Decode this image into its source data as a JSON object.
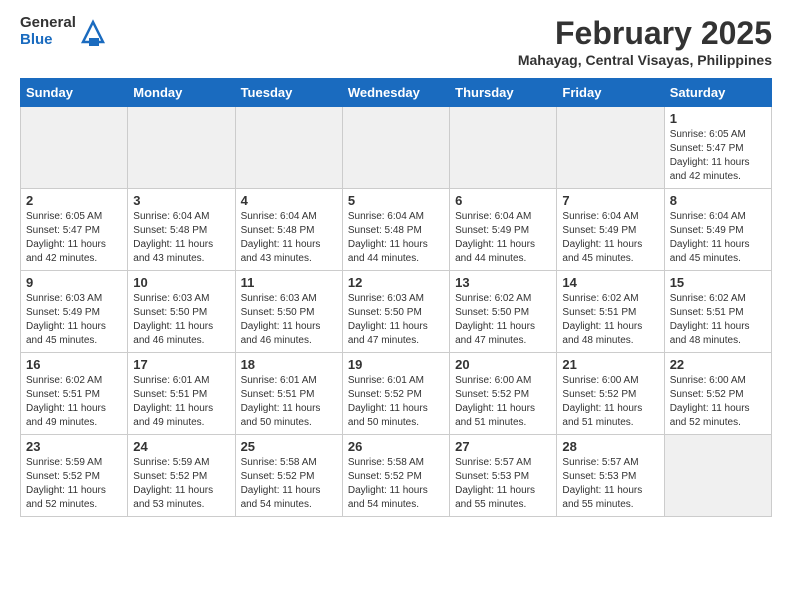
{
  "header": {
    "logo_general": "General",
    "logo_blue": "Blue",
    "month_title": "February 2025",
    "location": "Mahayag, Central Visayas, Philippines"
  },
  "days_of_week": [
    "Sunday",
    "Monday",
    "Tuesday",
    "Wednesday",
    "Thursday",
    "Friday",
    "Saturday"
  ],
  "weeks": [
    [
      {
        "num": "",
        "info": "",
        "empty": true
      },
      {
        "num": "",
        "info": "",
        "empty": true
      },
      {
        "num": "",
        "info": "",
        "empty": true
      },
      {
        "num": "",
        "info": "",
        "empty": true
      },
      {
        "num": "",
        "info": "",
        "empty": true
      },
      {
        "num": "",
        "info": "",
        "empty": true
      },
      {
        "num": "1",
        "info": "Sunrise: 6:05 AM\nSunset: 5:47 PM\nDaylight: 11 hours\nand 42 minutes."
      }
    ],
    [
      {
        "num": "2",
        "info": "Sunrise: 6:05 AM\nSunset: 5:47 PM\nDaylight: 11 hours\nand 42 minutes."
      },
      {
        "num": "3",
        "info": "Sunrise: 6:04 AM\nSunset: 5:48 PM\nDaylight: 11 hours\nand 43 minutes."
      },
      {
        "num": "4",
        "info": "Sunrise: 6:04 AM\nSunset: 5:48 PM\nDaylight: 11 hours\nand 43 minutes."
      },
      {
        "num": "5",
        "info": "Sunrise: 6:04 AM\nSunset: 5:48 PM\nDaylight: 11 hours\nand 44 minutes."
      },
      {
        "num": "6",
        "info": "Sunrise: 6:04 AM\nSunset: 5:49 PM\nDaylight: 11 hours\nand 44 minutes."
      },
      {
        "num": "7",
        "info": "Sunrise: 6:04 AM\nSunset: 5:49 PM\nDaylight: 11 hours\nand 45 minutes."
      },
      {
        "num": "8",
        "info": "Sunrise: 6:04 AM\nSunset: 5:49 PM\nDaylight: 11 hours\nand 45 minutes."
      }
    ],
    [
      {
        "num": "9",
        "info": "Sunrise: 6:03 AM\nSunset: 5:49 PM\nDaylight: 11 hours\nand 45 minutes."
      },
      {
        "num": "10",
        "info": "Sunrise: 6:03 AM\nSunset: 5:50 PM\nDaylight: 11 hours\nand 46 minutes."
      },
      {
        "num": "11",
        "info": "Sunrise: 6:03 AM\nSunset: 5:50 PM\nDaylight: 11 hours\nand 46 minutes."
      },
      {
        "num": "12",
        "info": "Sunrise: 6:03 AM\nSunset: 5:50 PM\nDaylight: 11 hours\nand 47 minutes."
      },
      {
        "num": "13",
        "info": "Sunrise: 6:02 AM\nSunset: 5:50 PM\nDaylight: 11 hours\nand 47 minutes."
      },
      {
        "num": "14",
        "info": "Sunrise: 6:02 AM\nSunset: 5:51 PM\nDaylight: 11 hours\nand 48 minutes."
      },
      {
        "num": "15",
        "info": "Sunrise: 6:02 AM\nSunset: 5:51 PM\nDaylight: 11 hours\nand 48 minutes."
      }
    ],
    [
      {
        "num": "16",
        "info": "Sunrise: 6:02 AM\nSunset: 5:51 PM\nDaylight: 11 hours\nand 49 minutes."
      },
      {
        "num": "17",
        "info": "Sunrise: 6:01 AM\nSunset: 5:51 PM\nDaylight: 11 hours\nand 49 minutes."
      },
      {
        "num": "18",
        "info": "Sunrise: 6:01 AM\nSunset: 5:51 PM\nDaylight: 11 hours\nand 50 minutes."
      },
      {
        "num": "19",
        "info": "Sunrise: 6:01 AM\nSunset: 5:52 PM\nDaylight: 11 hours\nand 50 minutes."
      },
      {
        "num": "20",
        "info": "Sunrise: 6:00 AM\nSunset: 5:52 PM\nDaylight: 11 hours\nand 51 minutes."
      },
      {
        "num": "21",
        "info": "Sunrise: 6:00 AM\nSunset: 5:52 PM\nDaylight: 11 hours\nand 51 minutes."
      },
      {
        "num": "22",
        "info": "Sunrise: 6:00 AM\nSunset: 5:52 PM\nDaylight: 11 hours\nand 52 minutes."
      }
    ],
    [
      {
        "num": "23",
        "info": "Sunrise: 5:59 AM\nSunset: 5:52 PM\nDaylight: 11 hours\nand 52 minutes."
      },
      {
        "num": "24",
        "info": "Sunrise: 5:59 AM\nSunset: 5:52 PM\nDaylight: 11 hours\nand 53 minutes."
      },
      {
        "num": "25",
        "info": "Sunrise: 5:58 AM\nSunset: 5:52 PM\nDaylight: 11 hours\nand 54 minutes."
      },
      {
        "num": "26",
        "info": "Sunrise: 5:58 AM\nSunset: 5:52 PM\nDaylight: 11 hours\nand 54 minutes."
      },
      {
        "num": "27",
        "info": "Sunrise: 5:57 AM\nSunset: 5:53 PM\nDaylight: 11 hours\nand 55 minutes."
      },
      {
        "num": "28",
        "info": "Sunrise: 5:57 AM\nSunset: 5:53 PM\nDaylight: 11 hours\nand 55 minutes."
      },
      {
        "num": "",
        "info": "",
        "empty": true
      }
    ]
  ]
}
